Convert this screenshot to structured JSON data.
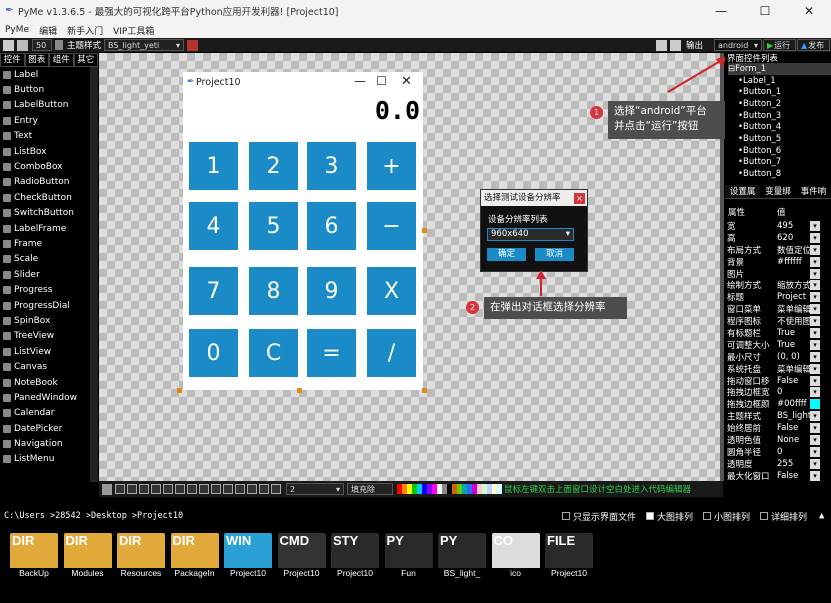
{
  "app": {
    "title": "PyMe v1.3.6.5 - 最强大的可视化跨平台Python应用开发利器! [Project10]"
  },
  "menu": [
    "PyMe",
    "编辑",
    "新手入门",
    "VIP工具箱"
  ],
  "toolbar": {
    "size": "50",
    "theme_label": "主题样式",
    "theme_value": "BS_light_yeti",
    "output_label": "输出",
    "platform": "android",
    "run": "运行",
    "publish": "发布"
  },
  "control_tabs": [
    "控件",
    "图表",
    "组件",
    "其它"
  ],
  "controls": [
    "Label",
    "Button",
    "LabelButton",
    "Entry",
    "Text",
    "ListBox",
    "ComboBox",
    "RadioButton",
    "CheckButton",
    "SwitchButton",
    "LabelFrame",
    "Frame",
    "Scale",
    "Slider",
    "Progress",
    "ProgressDial",
    "SpinBox",
    "TreeView",
    "ListView",
    "Canvas",
    "NoteBook",
    "PanedWindow",
    "Calendar",
    "DatePicker",
    "Navigation",
    "ListMenu"
  ],
  "form": {
    "title": "Project10",
    "display": "0.0",
    "buttons": [
      "1",
      "2",
      "3",
      "+",
      "4",
      "5",
      "6",
      "−",
      "7",
      "8",
      "9",
      "X",
      "0",
      "C",
      "=",
      "/"
    ]
  },
  "dialog": {
    "title": "选择测试设备分辨率",
    "close": "×",
    "label": "设备分辨率列表",
    "resolution": "960x640",
    "ok": "确定",
    "cancel": "取消"
  },
  "callouts": [
    {
      "num": "1",
      "text": "选择“android”平台\n并点击“运行”按钮"
    },
    {
      "num": "2",
      "text": "在弹出对话框选择分辨率"
    }
  ],
  "right_panel": {
    "header": "界面控件列表",
    "tree": [
      "Form_1",
      "Label_1",
      "Button_1",
      "Button_2",
      "Button_3",
      "Button_4",
      "Button_5",
      "Button_6",
      "Button_7",
      "Button_8"
    ],
    "tabs": [
      "设置属",
      "变量绑",
      "事件响"
    ],
    "col_prop": "属性",
    "col_val": "值",
    "props": [
      [
        "宽",
        "495"
      ],
      [
        "高",
        "620"
      ],
      [
        "布局方式",
        "数值定位"
      ],
      [
        "背景",
        "#ffffff"
      ],
      [
        "图片",
        ""
      ],
      [
        "绘制方式",
        "缩放方式"
      ],
      [
        "标题",
        "Project"
      ],
      [
        "窗口菜单",
        "菜单编辑"
      ],
      [
        "程序图标",
        "不使用图"
      ],
      [
        "有标题栏",
        "True"
      ],
      [
        "可调整大小",
        "True"
      ],
      [
        "最小尺寸",
        "(0, 0)"
      ],
      [
        "系统托盘",
        "菜单编辑"
      ],
      [
        "拖动窗口移",
        "False"
      ],
      [
        "拖拽边框宽",
        "0"
      ],
      [
        "拖拽边框颜",
        "#00ffff"
      ],
      [
        "主题样式",
        "BS_light"
      ],
      [
        "始终居前",
        "False"
      ],
      [
        "透明色值",
        "None"
      ],
      [
        "圆角半径",
        "0"
      ],
      [
        "透明度",
        "255"
      ],
      [
        "最大化窗口",
        "False"
      ]
    ]
  },
  "drawbar": {
    "width": "2",
    "fill": "填充除",
    "hint": "鼠标左键双击上面窗口设计空白处进入代码编辑器"
  },
  "path": "C:\\Users >28542 >Desktop >Project10",
  "view_options": [
    "只显示界面文件",
    "大图排列",
    "小图排列",
    "详细排列"
  ],
  "files": [
    {
      "type": "DIR",
      "name": "BackUp"
    },
    {
      "type": "DIR",
      "name": "Modules"
    },
    {
      "type": "DIR",
      "name": "Resources"
    },
    {
      "type": "DIR",
      "name": "PackageIn"
    },
    {
      "type": "WIN",
      "name": "Project10"
    },
    {
      "type": "CMD",
      "name": "Project10"
    },
    {
      "type": "STY",
      "name": "Project10"
    },
    {
      "type": "PY",
      "name": "Fun"
    },
    {
      "type": "PY",
      "name": "BS_light_"
    },
    {
      "type": "CO",
      "name": "ico"
    },
    {
      "type": "FILE",
      "name": "Project10"
    }
  ]
}
